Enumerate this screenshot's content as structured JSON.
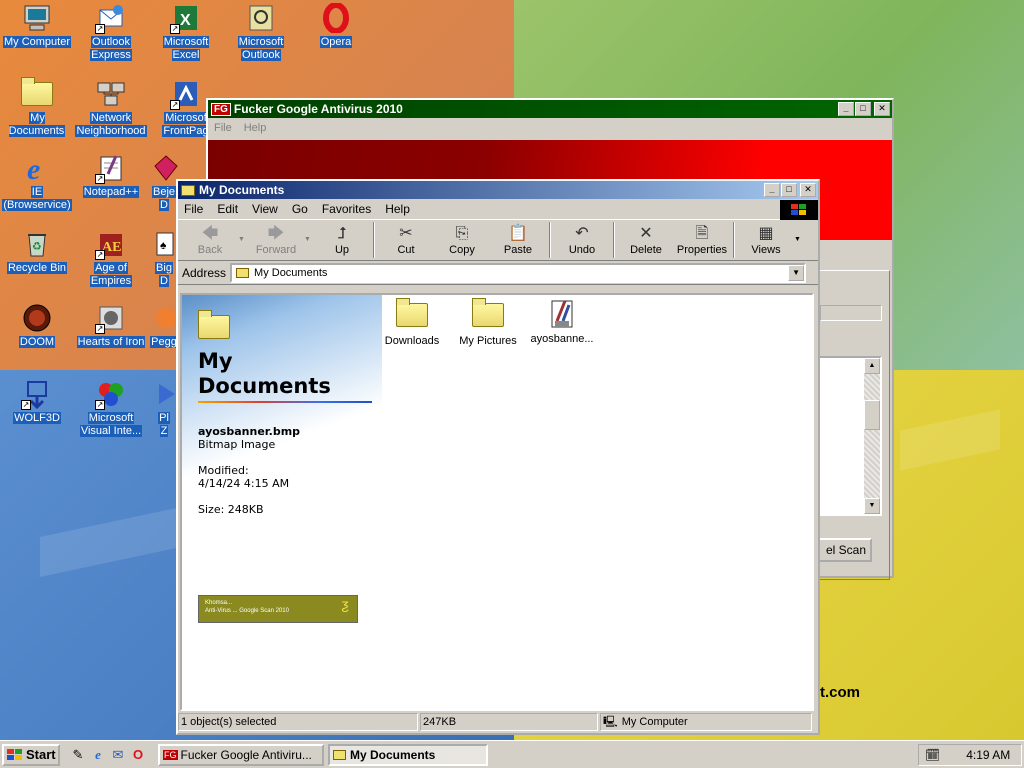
{
  "desktop": {
    "icons": [
      {
        "label1": "My Computer",
        "label2": "",
        "glyph": "🖥"
      },
      {
        "label1": "Outlook",
        "label2": "Express",
        "glyph": "✉"
      },
      {
        "label1": "Microsoft",
        "label2": "Excel",
        "glyph": "X"
      },
      {
        "label1": "Microsoft",
        "label2": "Outlook",
        "glyph": "✉"
      },
      {
        "label1": "Opera",
        "label2": "",
        "glyph": "O"
      },
      {
        "label1": "My Documents",
        "label2": "",
        "glyph": "📁"
      },
      {
        "label1": "Network",
        "label2": "Neighborhood",
        "glyph": "🖧"
      },
      {
        "label1": "Microsof",
        "label2": "FrontPag",
        "glyph": "F"
      },
      {
        "label1": "IE",
        "label2": "(Browservice)",
        "glyph": "e"
      },
      {
        "label1": "Notepad++",
        "label2": "",
        "glyph": "✎"
      },
      {
        "label1": "Beje",
        "label2": "D",
        "glyph": "◆"
      },
      {
        "label1": "Recycle Bin",
        "label2": "",
        "glyph": "♻"
      },
      {
        "label1": "Age of",
        "label2": "Empires",
        "glyph": "⚔"
      },
      {
        "label1": "Big",
        "label2": "D",
        "glyph": "♠"
      },
      {
        "label1": "DOOM",
        "label2": "",
        "glyph": "☠"
      },
      {
        "label1": "Hearts of Iron",
        "label2": "",
        "glyph": "⚑"
      },
      {
        "label1": "Pegg",
        "label2": "",
        "glyph": "●"
      },
      {
        "label1": "WOLF3D",
        "label2": "",
        "glyph": "⚡"
      },
      {
        "label1": "Microsoft",
        "label2": "Visual Inte...",
        "glyph": "◈"
      },
      {
        "label1": "Pl",
        "label2": "Z",
        "glyph": "▶"
      }
    ]
  },
  "antivirus_window": {
    "title": "Fucker Google Antivirus 2010",
    "logo": "FG",
    "menu": [
      "File",
      "Help"
    ],
    "scan_button": "el Scan",
    "footer_text": "t.com"
  },
  "my_documents_window": {
    "title": "My Documents",
    "menu": [
      "File",
      "Edit",
      "View",
      "Go",
      "Favorites",
      "Help"
    ],
    "toolbar": {
      "back": "Back",
      "forward": "Forward",
      "up": "Up",
      "cut": "Cut",
      "copy": "Copy",
      "paste": "Paste",
      "undo": "Undo",
      "delete": "Delete",
      "properties": "Properties",
      "views": "Views"
    },
    "address_label": "Address",
    "address_value": "My Documents",
    "sidebar": {
      "title_line1": "My",
      "title_line2": "Documents",
      "file_name": "ayosbanner.bmp",
      "file_type": "Bitmap Image",
      "modified_label": "Modified:",
      "modified_value": "4/14/24 4:15 AM",
      "size": "Size: 248KB",
      "thumb_line1": "Khomsa...",
      "thumb_line2": "Anti-Virus ... Google Scan 2010"
    },
    "files": [
      {
        "name": "Downloads",
        "kind": "folder"
      },
      {
        "name": "My Pictures",
        "kind": "folder"
      },
      {
        "name": "ayosbanne...",
        "kind": "image"
      }
    ],
    "status": {
      "selection": "1 object(s) selected",
      "size": "247KB",
      "zone": "My Computer"
    }
  },
  "taskbar": {
    "start_label": "Start",
    "tasks": [
      {
        "label": "Fucker Google Antiviru...",
        "icon": "FG"
      },
      {
        "label": "My Documents",
        "icon": "📁"
      }
    ],
    "clock": "4:19 AM"
  },
  "colors": {
    "title_active": "#0a246a",
    "title_inactive": "#004000",
    "banner_red": "#ff0000",
    "face": "#d4d0c8"
  }
}
